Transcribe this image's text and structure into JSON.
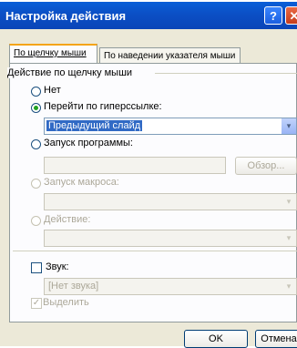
{
  "dialog": {
    "title": "Настройка действия",
    "help_glyph": "?",
    "close_glyph": "✕"
  },
  "tabs": [
    {
      "label": "По щелчку мыши"
    },
    {
      "label": "По наведении указателя мыши"
    }
  ],
  "group": {
    "label": "Действие по щелчку мыши"
  },
  "options": {
    "none": {
      "label": "Нет",
      "selected": false
    },
    "hyperlink": {
      "label": "Перейти по гиперссылке:",
      "selected": true,
      "value": "Предыдущий слайд",
      "arrow": "▾"
    },
    "program": {
      "label": "Запуск программы:",
      "selected": false,
      "browse": "Обзор..."
    },
    "macro": {
      "label": "Запуск макроса:",
      "selected": false,
      "enabled": false,
      "arrow": "▾"
    },
    "action": {
      "label": "Действие:",
      "selected": false,
      "enabled": false,
      "arrow": "▾"
    }
  },
  "sound": {
    "label": "Звук:",
    "checked": false,
    "value": "[Нет звука]",
    "arrow": "▾"
  },
  "highlight": {
    "label": "Выделить",
    "checked": true,
    "enabled": false,
    "mark": "✓"
  },
  "buttons": {
    "ok": "OK",
    "cancel": "Отмена"
  }
}
